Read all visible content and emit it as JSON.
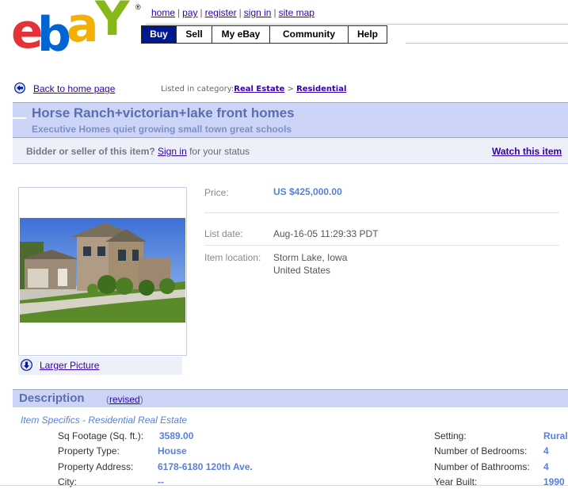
{
  "header": {
    "logo_text": "ebay",
    "logo_registered": "®",
    "top_links": [
      "home",
      "pay",
      "register",
      "sign in",
      "site map"
    ],
    "nav_tabs": [
      {
        "label": "Buy",
        "active": true
      },
      {
        "label": "Sell",
        "active": false
      },
      {
        "label": "My eBay",
        "active": false
      },
      {
        "label": "Community",
        "active": false
      },
      {
        "label": "Help",
        "active": false
      }
    ]
  },
  "breadcrumb": {
    "back_link": "Back to home page",
    "listed_prefix": "Listed in category:",
    "category": "Real Estate",
    "separator": ">",
    "subcategory": "Residential"
  },
  "item": {
    "title": "Horse Ranch+victorian+lake front homes",
    "subtitle": "Executive Homes quiet growing small town great schools"
  },
  "bidder_bar": {
    "prefix": "Bidder or seller of this item?",
    "sign_in": "Sign in",
    "suffix": "for your status",
    "watch": "Watch this item"
  },
  "picture": {
    "larger_link": "Larger Picture"
  },
  "details": {
    "price_label": "Price:",
    "price_value": "US $425,000.00",
    "date_label": "List date:",
    "date_value": "Aug-16-05 11:29:33 PDT",
    "location_label": "Item location:",
    "location_line1": "Storm Lake, Iowa",
    "location_line2": "United States"
  },
  "description": {
    "title": "Description",
    "revised": "revised",
    "specifics_heading": "Item Specifics - Residential Real Estate",
    "left_specs": [
      {
        "label": "Sq Footage (Sq. ft.):",
        "value": "3589.00"
      },
      {
        "label": "Property Type:",
        "value": "House"
      },
      {
        "label": "Property Address:",
        "value": "6178-6180 120th Ave."
      },
      {
        "label": "City:",
        "value": "--"
      }
    ],
    "right_specs": [
      {
        "label": "Setting:",
        "value": "Rural"
      },
      {
        "label": "Number of Bedrooms:",
        "value": "4"
      },
      {
        "label": "Number of Bathrooms:",
        "value": "4"
      },
      {
        "label": "Year Built:",
        "value": "1990"
      }
    ]
  },
  "colors": {
    "nav_active": "#00188f",
    "title_band": "#ccd4f8",
    "title_text": "#5a6fb0",
    "link": "#3300aa",
    "price": "#5a7fd8"
  }
}
